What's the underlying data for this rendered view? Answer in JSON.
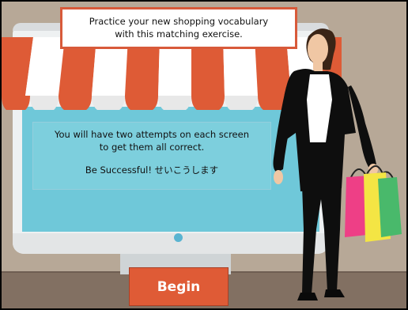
{
  "title": {
    "line1": "Practice your new shopping vocabulary",
    "line2": "with this matching exercise."
  },
  "instructions": {
    "line1": "You will have two attempts on each screen",
    "line2": "to get them all correct.",
    "line3": "Be Successful! せいこうします"
  },
  "begin_button": {
    "label": "Begin"
  },
  "colors": {
    "accent": "#df5b36",
    "screen": "#6fc8d9",
    "wall": "#b7a897",
    "floor": "#827062"
  }
}
